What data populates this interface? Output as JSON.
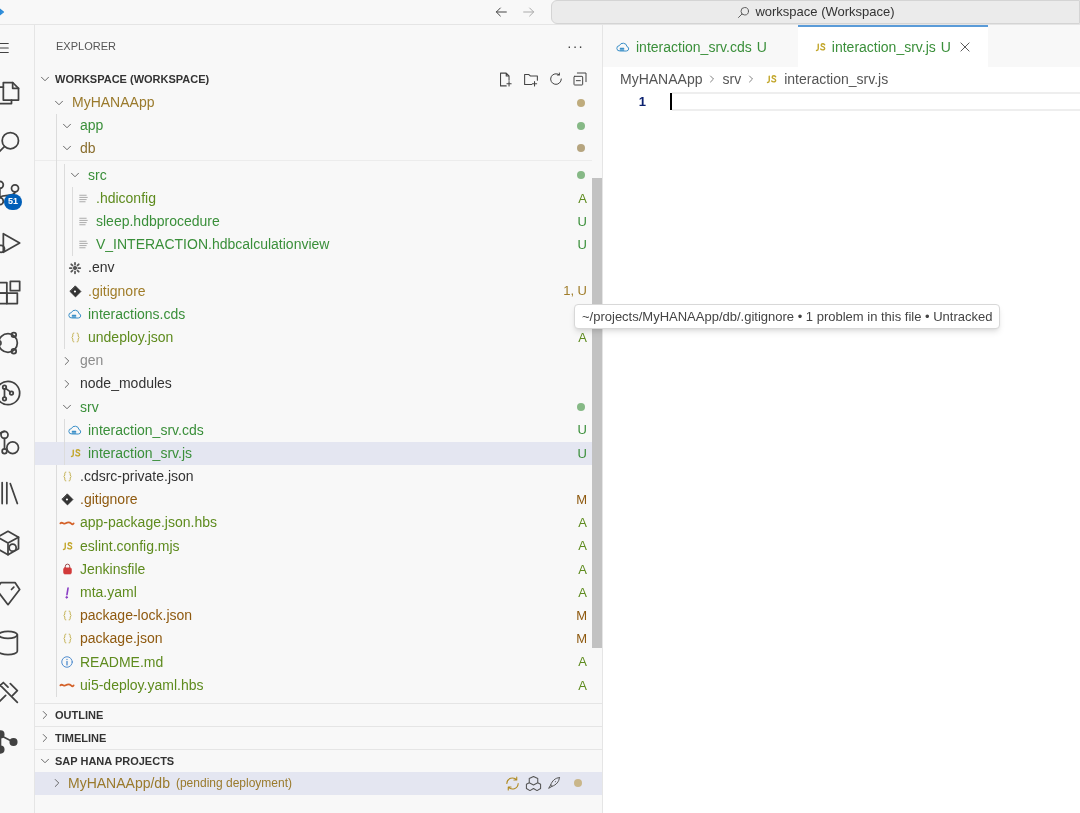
{
  "title_bar": {
    "search": "workspace (Workspace)"
  },
  "activity_bar": {
    "source_control_badge": "51"
  },
  "explorer": {
    "title": "EXPLORER",
    "more": "···",
    "workspace": {
      "label": "WORKSPACE (WORKSPACE)",
      "expanded": true
    },
    "tree": [
      {
        "label": "MyHANAApp",
        "kind": "folder",
        "expanded": true,
        "color": "#9a7a2c",
        "decoration_dot": true,
        "selected": false,
        "children": [
          {
            "label": "app",
            "kind": "folder",
            "expanded": true,
            "color": "#3a8f3a",
            "decoration_dot": true,
            "selected": false
          },
          {
            "label": "db",
            "kind": "folder",
            "expanded": true,
            "color": "#8a6e2e",
            "decoration_dot": true,
            "selected": false,
            "children": [
              {
                "label": "src",
                "kind": "folder",
                "expanded": true,
                "color": "#3a8f3a",
                "decoration_dot": true,
                "selected": false,
                "children": [
                  {
                    "label": ".hdiconfig",
                    "kind": "text",
                    "color": "#5e8b1e",
                    "decoration": "A",
                    "selected": false
                  },
                  {
                    "label": "sleep.hdbprocedure",
                    "kind": "text",
                    "color": "#3a8f3a",
                    "decoration": "U",
                    "selected": false
                  },
                  {
                    "label": "V_INTERACTION.hdbcalculationview",
                    "kind": "text",
                    "color": "#3a8f3a",
                    "decoration": "U",
                    "selected": false
                  }
                ]
              },
              {
                "label": ".env",
                "kind": "gear",
                "color": "#333333",
                "selected": false
              },
              {
                "label": ".gitignore",
                "kind": "git",
                "color": "#a07d2a",
                "decoration": "1, U",
                "selected": false
              },
              {
                "label": "interactions.cds",
                "kind": "cds",
                "color": "#3a8f3a",
                "selected": false
              },
              {
                "label": "undeploy.json",
                "kind": "json",
                "color": "#5e8b1e",
                "decoration": "A",
                "selected": false
              }
            ]
          },
          {
            "label": "gen",
            "kind": "folder",
            "expanded": false,
            "color": "#8c8c8c",
            "decoration_dot": false,
            "selected": false
          },
          {
            "label": "node_modules",
            "kind": "folder",
            "expanded": false,
            "color": "#333333",
            "decoration_dot": false,
            "selected": false
          },
          {
            "label": "srv",
            "kind": "folder",
            "expanded": true,
            "color": "#3a8f3a",
            "decoration_dot": true,
            "selected": false,
            "children": [
              {
                "label": "interaction_srv.cds",
                "kind": "cds",
                "color": "#3a8f3a",
                "decoration": "U",
                "selected": false
              },
              {
                "label": "interaction_srv.js",
                "kind": "js",
                "color": "#3a8f3a",
                "decoration": "U",
                "selected": true
              }
            ]
          },
          {
            "label": ".cdsrc-private.json",
            "kind": "json",
            "color": "#333333",
            "selected": false
          },
          {
            "label": ".gitignore",
            "kind": "git",
            "color": "#8f5a10",
            "decoration": "M",
            "selected": false
          },
          {
            "label": "app-package.json.hbs",
            "kind": "template",
            "color": "#5e8b1e",
            "decoration": "A",
            "selected": false
          },
          {
            "label": "eslint.config.mjs",
            "kind": "js",
            "color": "#5e8b1e",
            "decoration": "A",
            "selected": false
          },
          {
            "label": "Jenkinsfile",
            "kind": "jenkins",
            "color": "#5e8b1e",
            "decoration": "A",
            "selected": false
          },
          {
            "label": "mta.yaml",
            "kind": "yaml",
            "color": "#5e8b1e",
            "decoration": "A",
            "selected": false
          },
          {
            "label": "package-lock.json",
            "kind": "json",
            "color": "#8f5a10",
            "decoration": "M",
            "selected": false
          },
          {
            "label": "package.json",
            "kind": "json",
            "color": "#8f5a10",
            "decoration": "M",
            "selected": false
          },
          {
            "label": "README.md",
            "kind": "info",
            "color": "#5e8b1e",
            "decoration": "A",
            "selected": false
          },
          {
            "label": "ui5-deploy.yaml.hbs",
            "kind": "template",
            "color": "#5e8b1e",
            "decoration": "A",
            "selected": false
          }
        ]
      }
    ]
  },
  "sections": [
    {
      "label": "OUTLINE",
      "expanded": false
    },
    {
      "label": "TIMELINE",
      "expanded": false
    },
    {
      "label": "SAP HANA PROJECTS",
      "expanded": true,
      "items": [
        {
          "label": "MyHANAApp/db",
          "note": "(pending deployment)",
          "expanded": false,
          "selected": true
        }
      ]
    }
  ],
  "tooltip": "~/projects/MyHANAApp/db/.gitignore • 1 problem in this file • Untracked",
  "editor": {
    "tabs": [
      {
        "label": "interaction_srv.cds",
        "kind": "cds",
        "decoration": "U",
        "selected": false
      },
      {
        "label": "interaction_srv.js",
        "kind": "js",
        "decoration": "U",
        "selected": true
      }
    ],
    "breadcrumb": [
      {
        "label": "MyHANAApp",
        "kind": "folder"
      },
      {
        "label": "srv",
        "kind": "folder"
      },
      {
        "label": "interaction_srv.js",
        "kind": "js"
      }
    ],
    "lines": [
      {
        "number": "1",
        "current": true
      }
    ]
  }
}
